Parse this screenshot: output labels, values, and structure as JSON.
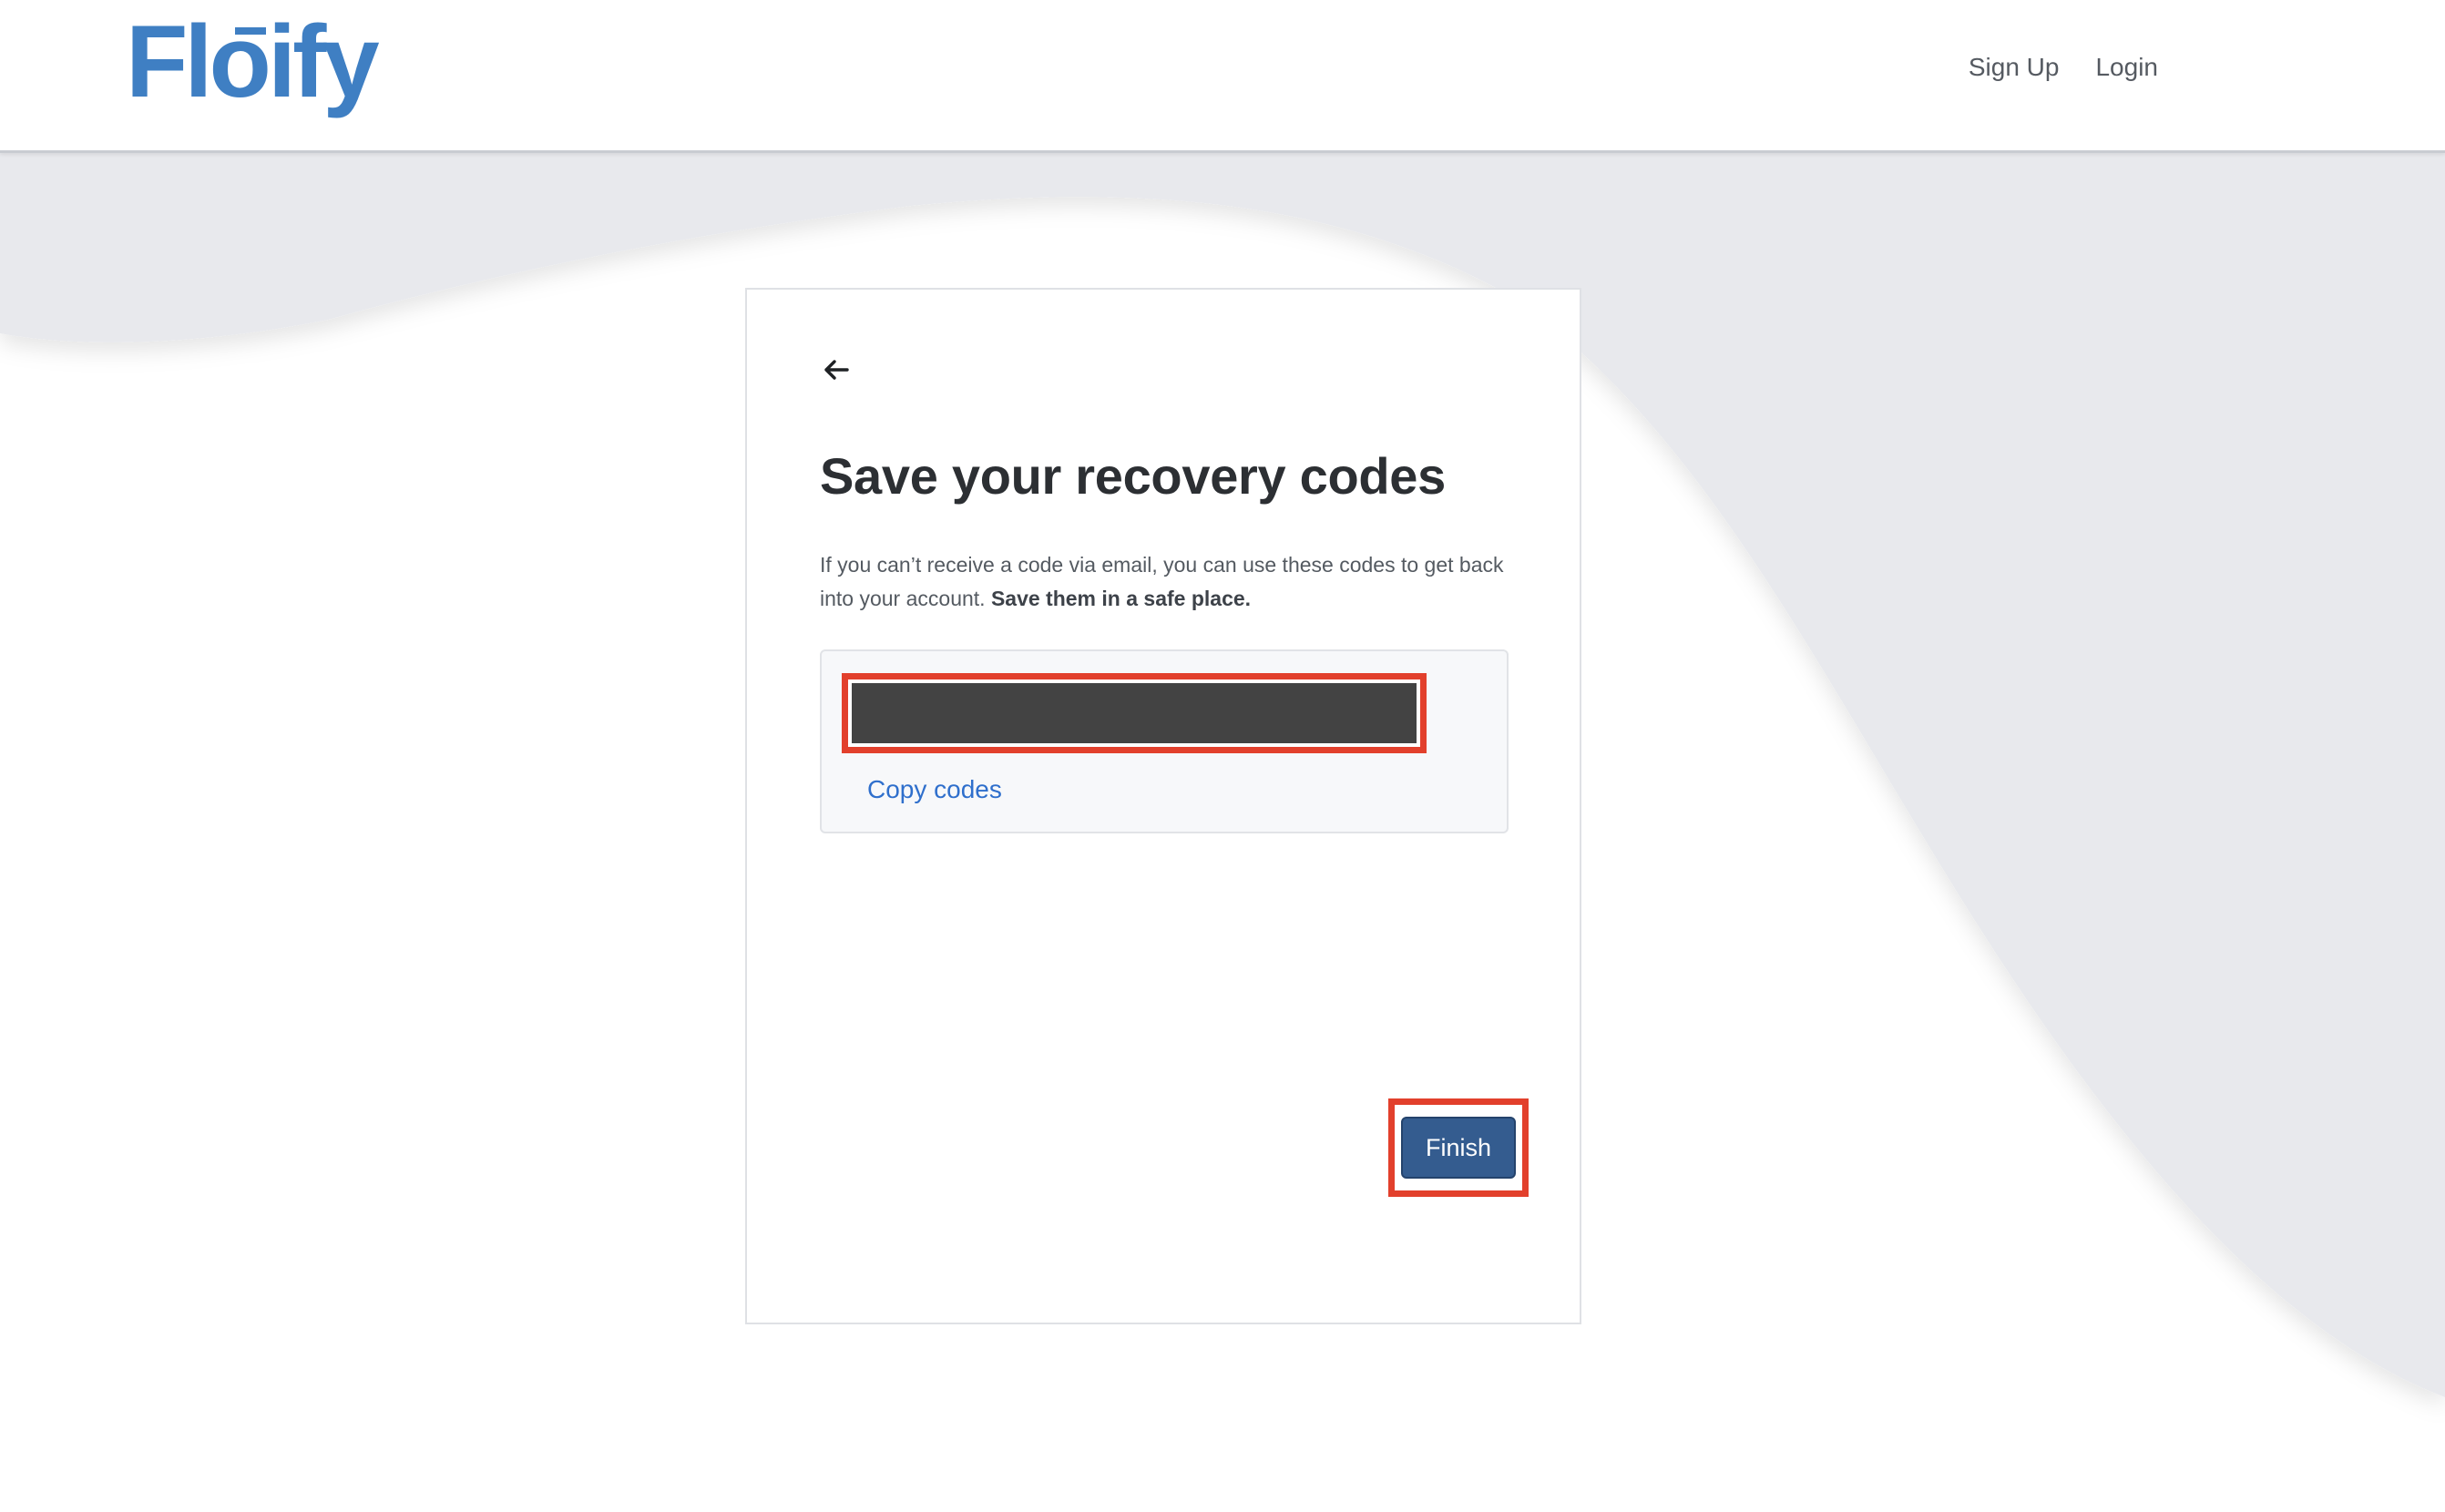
{
  "header": {
    "logo_text": "Floify",
    "nav": {
      "signup_label": "Sign Up",
      "login_label": "Login"
    }
  },
  "card": {
    "title": "Save your recovery codes",
    "description_text": "If you can’t receive a code via email, you can use these codes to get back into your account. ",
    "description_emphasis": "Save them in a safe place.",
    "codes": {
      "copy_label": "Copy codes"
    },
    "finish_label": "Finish"
  },
  "icons": {
    "back": "arrow-left-icon"
  },
  "colors": {
    "brand_blue": "#3f7fc3",
    "link_blue": "#2f6fcc",
    "button_blue": "#345c8f",
    "highlight_red": "#e2402c",
    "background_gray": "#e8e9ed",
    "redacted": "#434343"
  }
}
